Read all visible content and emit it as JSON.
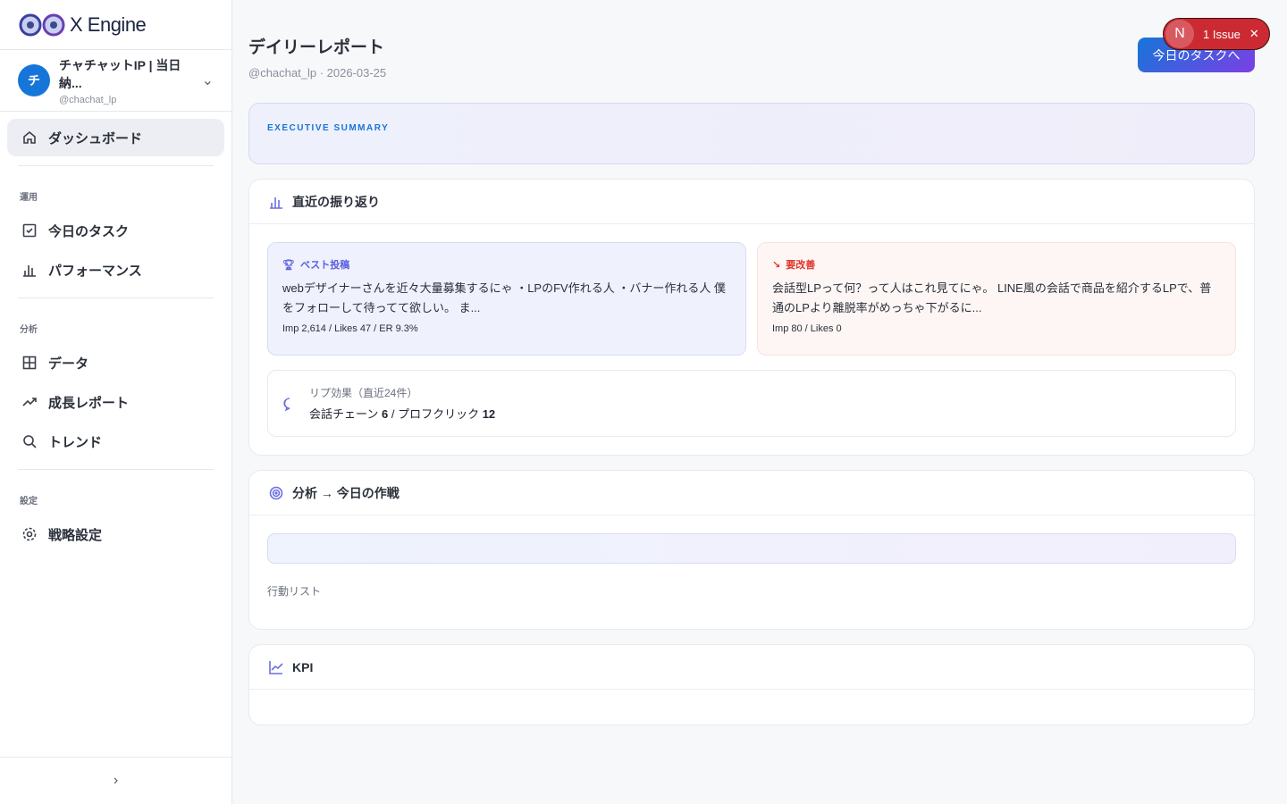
{
  "brand": {
    "name": "X Engine"
  },
  "account": {
    "initial": "チ",
    "name": "チャチャットIP | 当日納...",
    "handle": "@chachat_lp"
  },
  "nav": {
    "dashboard": "ダッシュボード",
    "group_ops": "運用",
    "tasks": "今日のタスク",
    "performance": "パフォーマンス",
    "group_analysis": "分析",
    "data": "データ",
    "growth": "成長レポート",
    "trend": "トレンド",
    "group_settings": "設定",
    "strategy": "戦略設定"
  },
  "header": {
    "title": "デイリーレポート",
    "subtitle": "@chachat_lp · 2026-03-25",
    "cta": "今日のタスクへ"
  },
  "issue": {
    "initial": "N",
    "label": "1 Issue"
  },
  "exec": {
    "label": "EXECUTIVE SUMMARY"
  },
  "review": {
    "title": "直近の振り返り",
    "best": {
      "tag": "ベスト投稿",
      "text": "webデザイナーさんを近々大量募集するにゃ ・LPのFV作れる人 ・バナー作れる人 僕をフォローして待ってて欲しい。 ま...",
      "stats": "Imp 2,614 / Likes 47 / ER 9.3%"
    },
    "bad": {
      "tag": "要改善",
      "text": "会話型LPって何？って人はこれ見てにゃ。 LINE風の会話で商品を紹介するLPで、普通のLPより離脱率がめっちゃ下がるに...",
      "stats": "Imp 80 / Likes 0"
    },
    "reply": {
      "label": "リプ効果（直近24件）",
      "chain_label": "会話チェーン",
      "chain": "6",
      "sep": " / ",
      "click_label": "プロフクリック",
      "click": "12"
    }
  },
  "plan": {
    "title": "分析 → 今日の作戦",
    "actions_label": "行動リスト"
  },
  "kpi": {
    "title": "KPI"
  },
  "colors": {
    "accent": "#1675d9",
    "best": "#5b5fe0",
    "bad": "#e0352b"
  }
}
